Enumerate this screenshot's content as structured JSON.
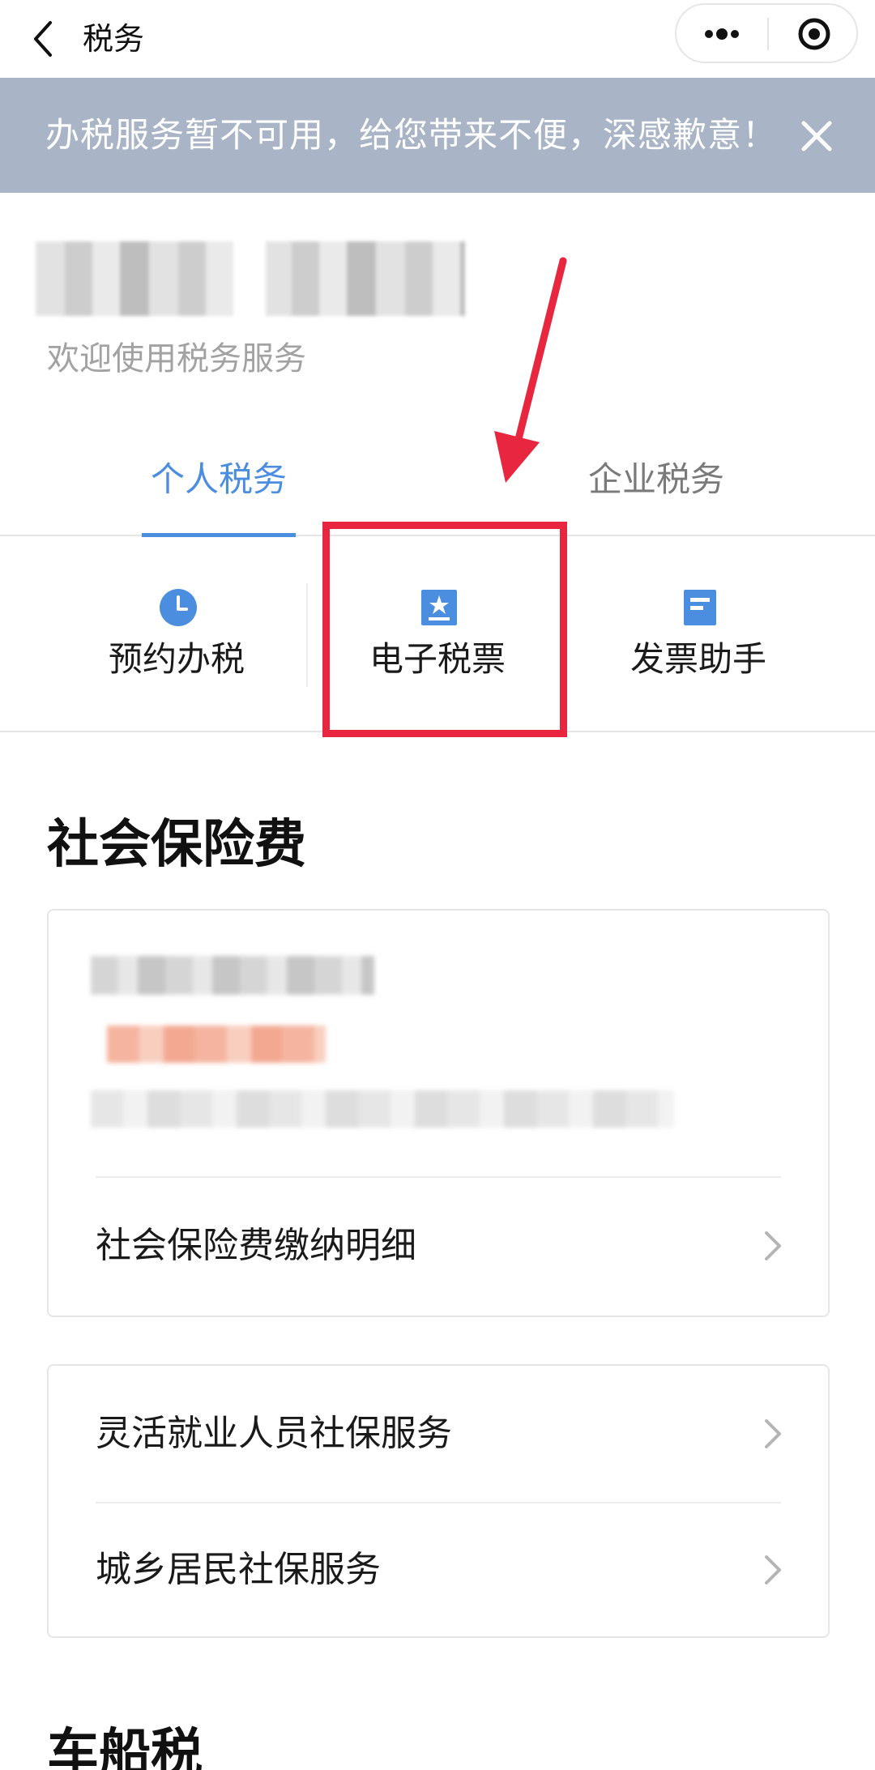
{
  "navbar": {
    "title": "税务",
    "back_icon": "chevron-left-icon",
    "more_icon": "more-dots-icon",
    "close_icon": "target-circle-icon"
  },
  "notice": {
    "text": "办税服务暂不可用，给您带来不便，深感歉意！",
    "close_icon": "close-icon"
  },
  "user": {
    "welcome": "欢迎使用税务服务"
  },
  "tabs": [
    {
      "label": "个人税务",
      "active": true
    },
    {
      "label": "企业税务",
      "active": false
    }
  ],
  "quick_services": [
    {
      "label": "预约办税",
      "icon": "clock-icon"
    },
    {
      "label": "电子税票",
      "icon": "star-ticket-icon"
    },
    {
      "label": "发票助手",
      "icon": "document-icon"
    }
  ],
  "section1": {
    "title": "社会保险费",
    "card1_row": "社会保险费缴纳明细",
    "card2_rows": [
      "灵活就业人员社保服务",
      "城乡居民社保服务"
    ]
  },
  "section2": {
    "title": "车船税"
  },
  "colors": {
    "accent": "#4b8ee0",
    "notice_bg": "#a9b5c6",
    "annotation": "#e8263f"
  }
}
